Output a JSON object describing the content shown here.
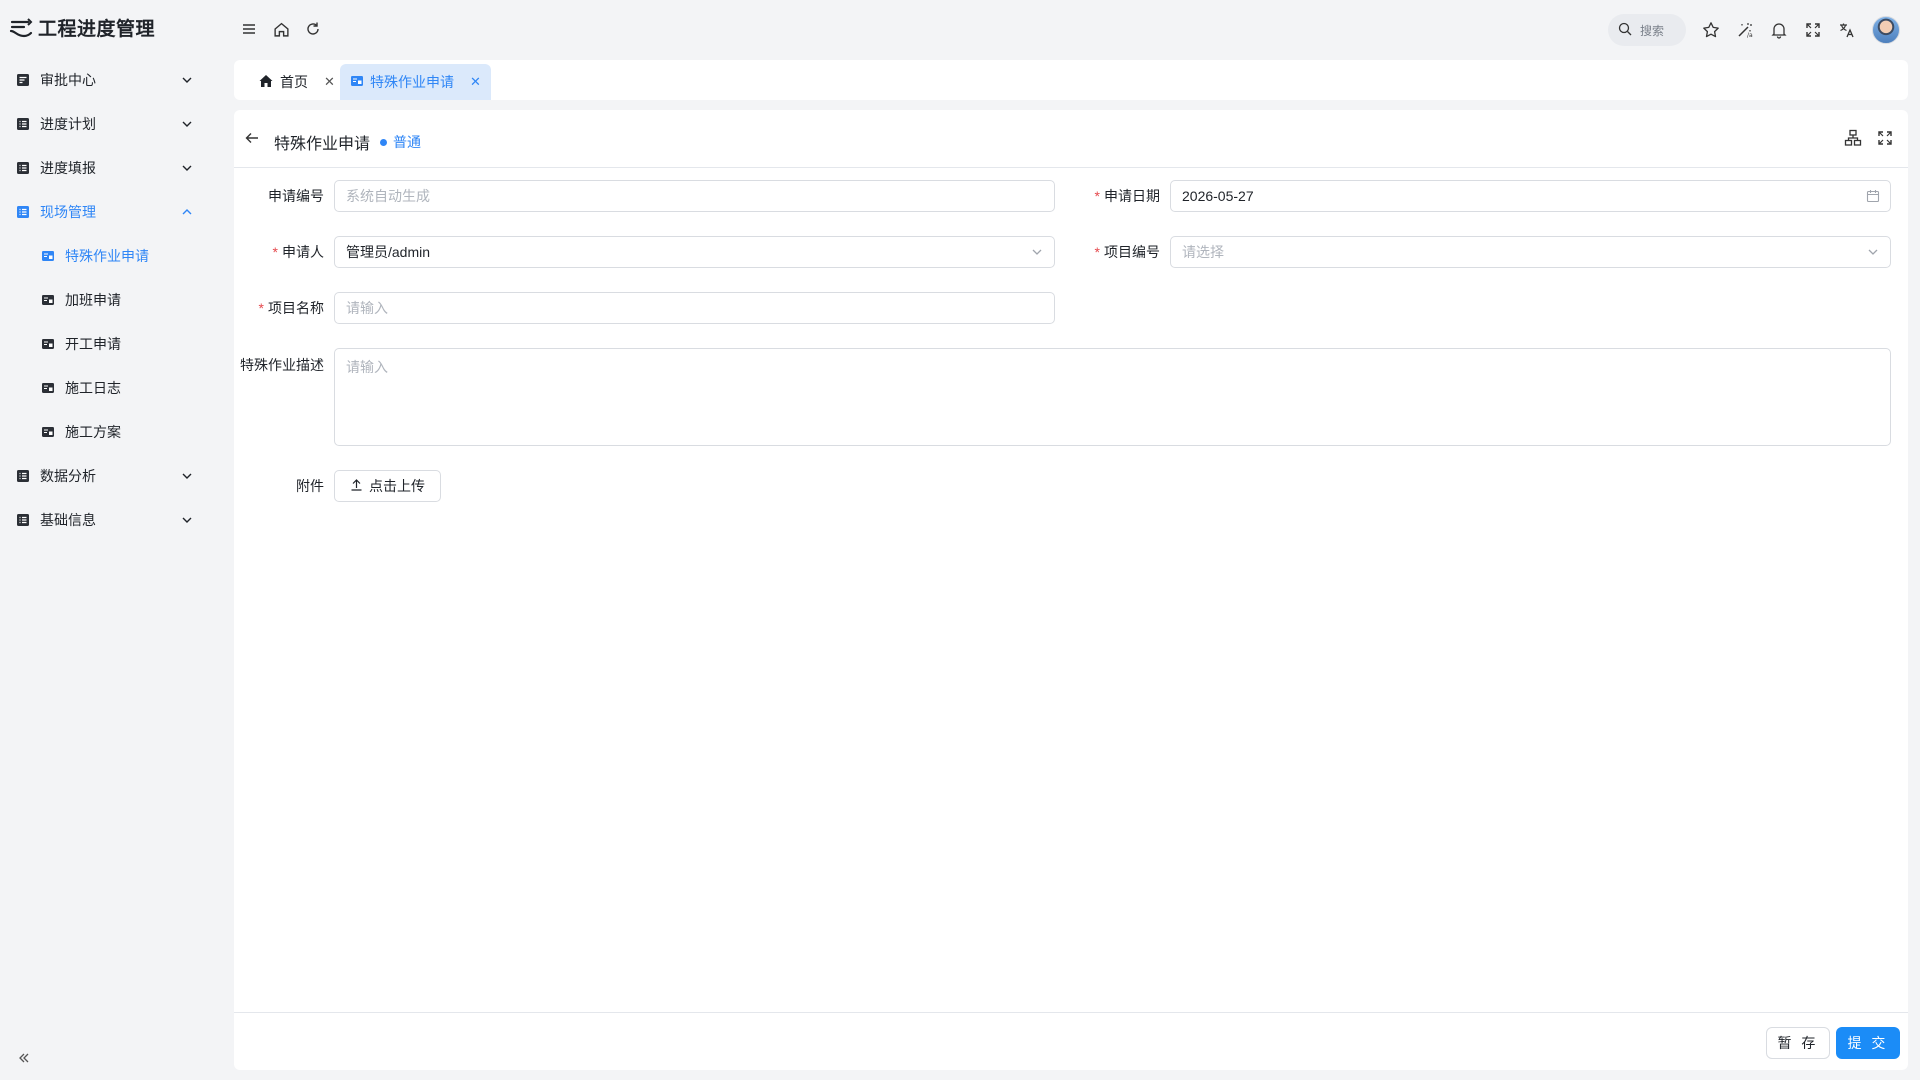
{
  "app": {
    "title": "工程进度管理"
  },
  "sidebar": {
    "items": [
      {
        "label": "审批中心",
        "icon": "approval-icon",
        "expanded": false
      },
      {
        "label": "进度计划",
        "icon": "list-icon",
        "expanded": false
      },
      {
        "label": "进度填报",
        "icon": "list-icon",
        "expanded": false
      },
      {
        "label": "现场管理",
        "icon": "list-icon",
        "expanded": true,
        "children": [
          {
            "label": "特殊作业申请",
            "active": true
          },
          {
            "label": "加班申请"
          },
          {
            "label": "开工申请"
          },
          {
            "label": "施工日志"
          },
          {
            "label": "施工方案"
          }
        ]
      },
      {
        "label": "数据分析",
        "icon": "list-icon",
        "expanded": false
      },
      {
        "label": "基础信息",
        "icon": "list-icon",
        "expanded": false
      }
    ]
  },
  "header": {
    "search_label": "搜索"
  },
  "tabs": [
    {
      "label": "首页",
      "icon": "home-icon",
      "active": false
    },
    {
      "label": "特殊作业申请",
      "icon": "form-icon",
      "active": true
    }
  ],
  "page": {
    "title": "特殊作业申请",
    "status": "普通"
  },
  "form": {
    "apply_no": {
      "label": "申请编号",
      "required": false,
      "placeholder": "系统自动生成",
      "value": ""
    },
    "apply_date": {
      "label": "申请日期",
      "required": true,
      "value": "2026-05-27"
    },
    "applicant": {
      "label": "申请人",
      "required": true,
      "value": "管理员/admin"
    },
    "project_no": {
      "label": "项目编号",
      "required": true,
      "placeholder": "请选择",
      "value": ""
    },
    "project_name": {
      "label": "项目名称",
      "required": true,
      "placeholder": "请输入",
      "value": ""
    },
    "description": {
      "label": "特殊作业描述",
      "required": false,
      "placeholder": "请输入",
      "value": ""
    },
    "attachment": {
      "label": "附件",
      "button": "点击上传"
    },
    "required_mark": "*"
  },
  "footer": {
    "save_label": "暂 存",
    "submit_label": "提 交"
  },
  "colors": {
    "accent": "#2f86f6",
    "primary_button": "#1b8cf7",
    "required": "#e5484d"
  }
}
